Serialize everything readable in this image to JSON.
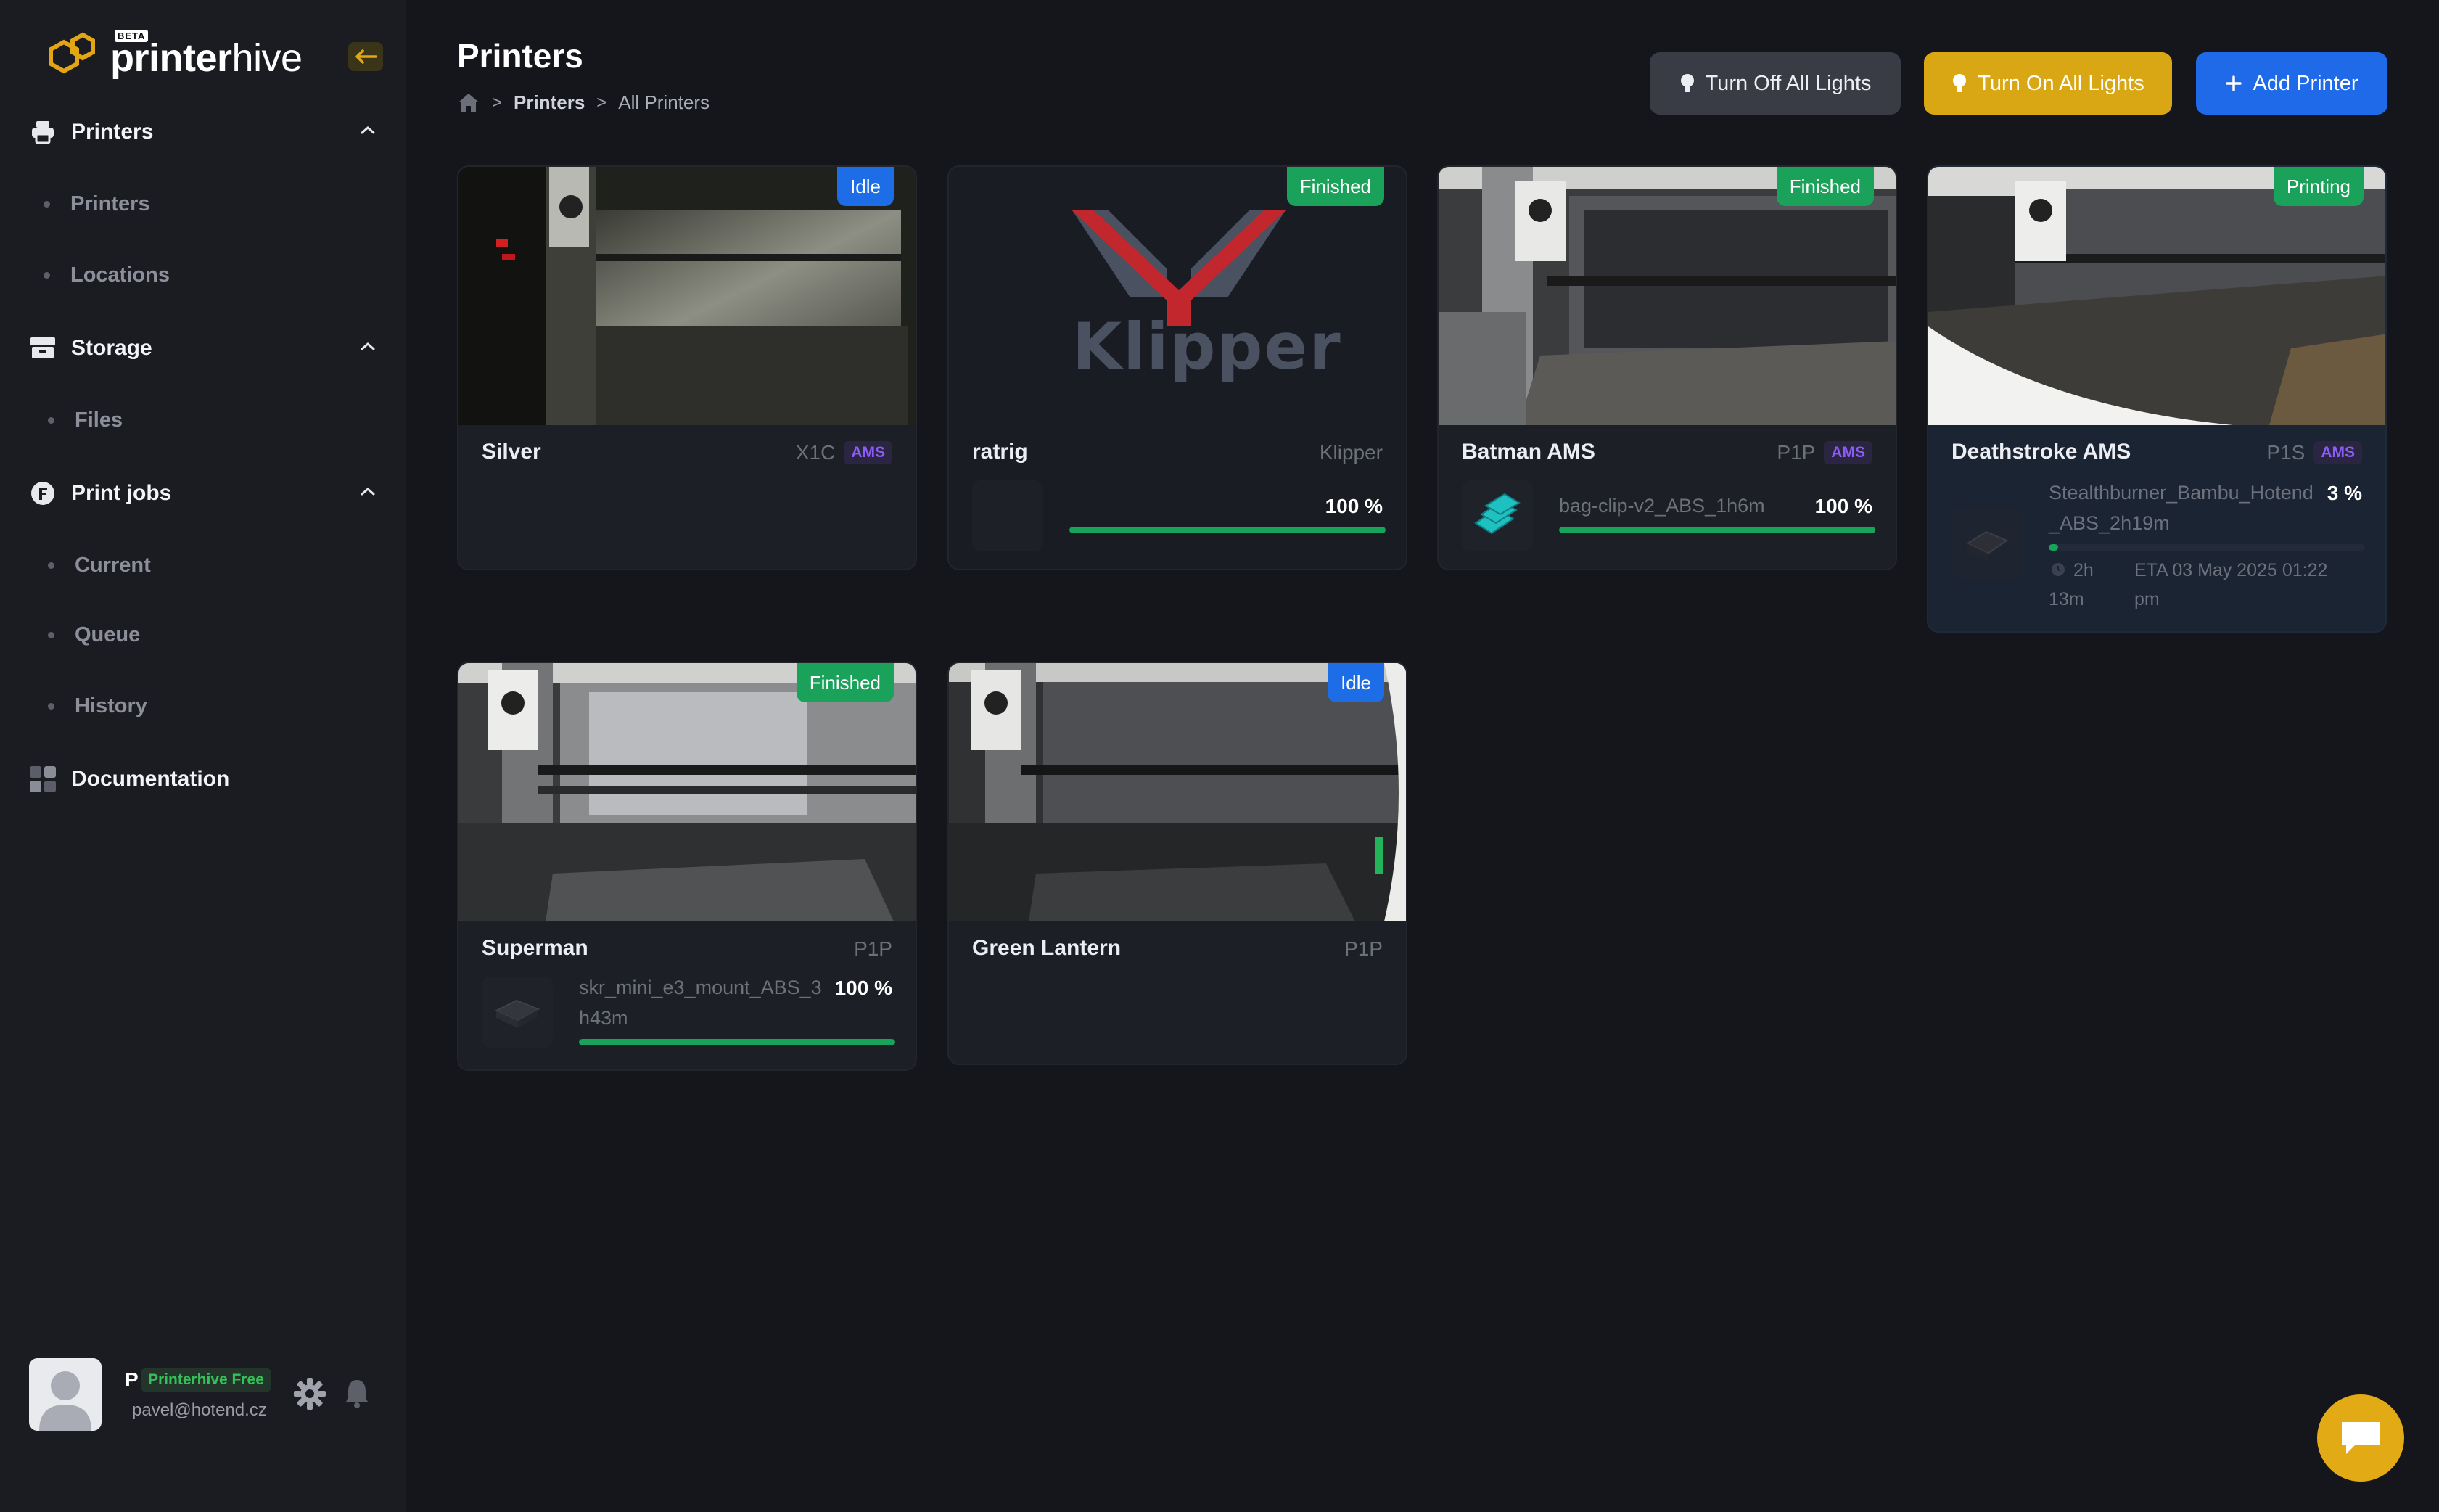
{
  "app": {
    "logo_text_bold": "printer",
    "logo_text_light": "hive",
    "logo_beta": "BETA"
  },
  "sidebar": {
    "groups": [
      {
        "label": "Printers",
        "icon": "printer-icon",
        "items": [
          "Printers",
          "Locations"
        ]
      },
      {
        "label": "Storage",
        "icon": "storage-icon",
        "items": [
          "Files"
        ]
      },
      {
        "label": "Print jobs",
        "icon": "print-jobs-icon",
        "items": [
          "Current",
          "Queue",
          "History"
        ]
      }
    ],
    "documentation_label": "Documentation",
    "user": {
      "initial": "P",
      "plan": "Printerhive Free",
      "email": "pavel@hotend.cz"
    }
  },
  "header": {
    "title": "Printers",
    "breadcrumb": [
      "Printers",
      "All Printers"
    ],
    "buttons": {
      "lights_off": "Turn Off All Lights",
      "lights_on": "Turn On All Lights",
      "add_printer": "Add Printer"
    }
  },
  "printers": [
    {
      "name": "Silver",
      "model": "X1C",
      "ams": "AMS",
      "status": "Idle"
    },
    {
      "name": "ratrig",
      "model": "Klipper",
      "status": "Finished",
      "camera_text": "Klipper",
      "progress_text": "100 %",
      "progress": 1.0
    },
    {
      "name": "Batman AMS",
      "model": "P1P",
      "ams": "AMS",
      "status": "Finished",
      "job": "bag-clip-v2_ABS_1h6m",
      "progress_text": "100 %",
      "progress": 1.0
    },
    {
      "name": "Deathstroke AMS",
      "model": "P1S",
      "ams": "AMS",
      "status": "Printing",
      "job_line1": "Stealthburner_Bambu_Hotend",
      "job_line2": "_ABS_2h19m",
      "progress_text": "3 %",
      "progress": 0.03,
      "remaining_line1": "2h",
      "remaining_line2": "13m",
      "eta_line1": "ETA 03 May 2025 01:22",
      "eta_line2": "pm"
    },
    {
      "name": "Superman",
      "model": "P1P",
      "status": "Finished",
      "job_line1": "skr_mini_e3_mount_ABS_3",
      "job_line2": "h43m",
      "progress_text": "100 %",
      "progress": 1.0
    },
    {
      "name": "Green Lantern",
      "model": "P1P",
      "status": "Idle"
    }
  ],
  "colors": {
    "accent_yellow": "#d9a714",
    "accent_blue": "#1e6ae8",
    "status_green": "#1aa15a",
    "ams_purple": "#8b5cf6"
  }
}
